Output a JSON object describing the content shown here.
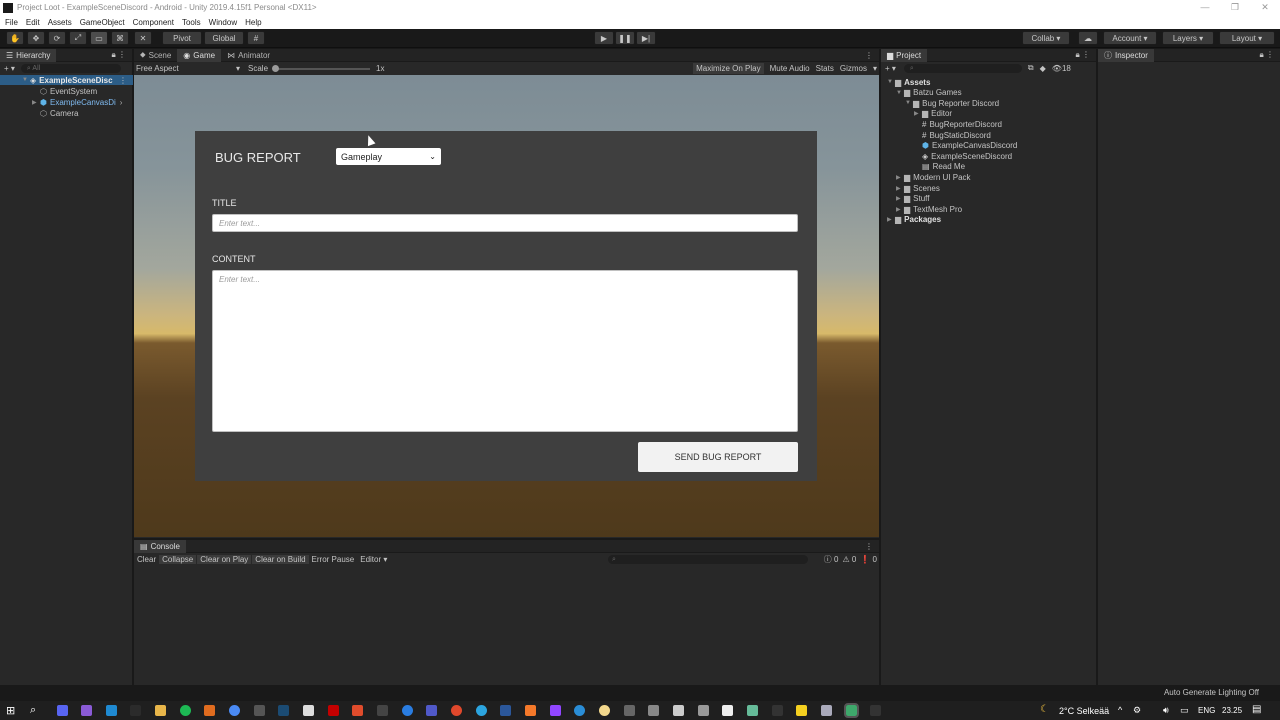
{
  "window": {
    "title": "Project Loot - ExampleSceneDiscord - Android - Unity 2019.4.15f1 Personal <DX11>",
    "controls": [
      "—",
      "❐",
      "✕"
    ]
  },
  "menu": [
    "File",
    "Edit",
    "Assets",
    "GameObject",
    "Component",
    "Tools",
    "Window",
    "Help"
  ],
  "toolbar": {
    "pivot": "Pivot",
    "global": "Global",
    "collab": "Collab ▾",
    "account": "Account",
    "layers": "Layers",
    "layout": "Layout"
  },
  "hierarchy": {
    "tab": "Hierarchy",
    "search_placeholder": "All",
    "items": [
      {
        "label": "ExampleSceneDisc",
        "depth": 0
      },
      {
        "label": "EventSystem",
        "depth": 1
      },
      {
        "label": "ExampleCanvasDi",
        "depth": 1
      },
      {
        "label": "Camera",
        "depth": 1
      }
    ]
  },
  "game": {
    "tabs": [
      "Scene",
      "Game",
      "Animator"
    ],
    "aspect": "Free Aspect",
    "scale_label": "Scale",
    "scale_value": "1x",
    "options": [
      "Maximize On Play",
      "Mute Audio",
      "Stats",
      "Gizmos"
    ]
  },
  "bug_report": {
    "title": "BUG REPORT",
    "category": "Gameplay",
    "title_label": "TITLE",
    "title_placeholder": "Enter text...",
    "content_label": "CONTENT",
    "content_placeholder": "Enter text...",
    "send_label": "SEND BUG REPORT"
  },
  "console": {
    "tab": "Console",
    "buttons": [
      "Clear",
      "Collapse",
      "Clear on Play",
      "Clear on Build",
      "Error Pause",
      "Editor ▾"
    ],
    "counts": [
      "0",
      "0",
      "0"
    ]
  },
  "project": {
    "tab": "Project",
    "count": "18",
    "tree": [
      {
        "label": "Assets",
        "depth": 0,
        "type": "folder",
        "bold": true
      },
      {
        "label": "Batzu Games",
        "depth": 1,
        "type": "folder"
      },
      {
        "label": "Bug Reporter Discord",
        "depth": 2,
        "type": "folder"
      },
      {
        "label": "Editor",
        "depth": 3,
        "type": "folder"
      },
      {
        "label": "BugReporterDiscord",
        "depth": 3,
        "type": "script"
      },
      {
        "label": "BugStaticDiscord",
        "depth": 3,
        "type": "script"
      },
      {
        "label": "ExampleCanvasDiscord",
        "depth": 3,
        "type": "prefab"
      },
      {
        "label": "ExampleSceneDiscord",
        "depth": 3,
        "type": "scene"
      },
      {
        "label": "Read Me",
        "depth": 3,
        "type": "doc"
      },
      {
        "label": "Modern UI Pack",
        "depth": 1,
        "type": "folder"
      },
      {
        "label": "Scenes",
        "depth": 1,
        "type": "folder"
      },
      {
        "label": "Stuff",
        "depth": 1,
        "type": "folder"
      },
      {
        "label": "TextMesh Pro",
        "depth": 1,
        "type": "folder"
      },
      {
        "label": "Packages",
        "depth": 0,
        "type": "folder",
        "bold": true
      }
    ]
  },
  "inspector": {
    "tab": "Inspector"
  },
  "status": {
    "text": "Auto Generate Lighting Off"
  },
  "taskbar": {
    "weather": "2°C Selkeää",
    "lang": "ENG",
    "time": "23.25"
  }
}
